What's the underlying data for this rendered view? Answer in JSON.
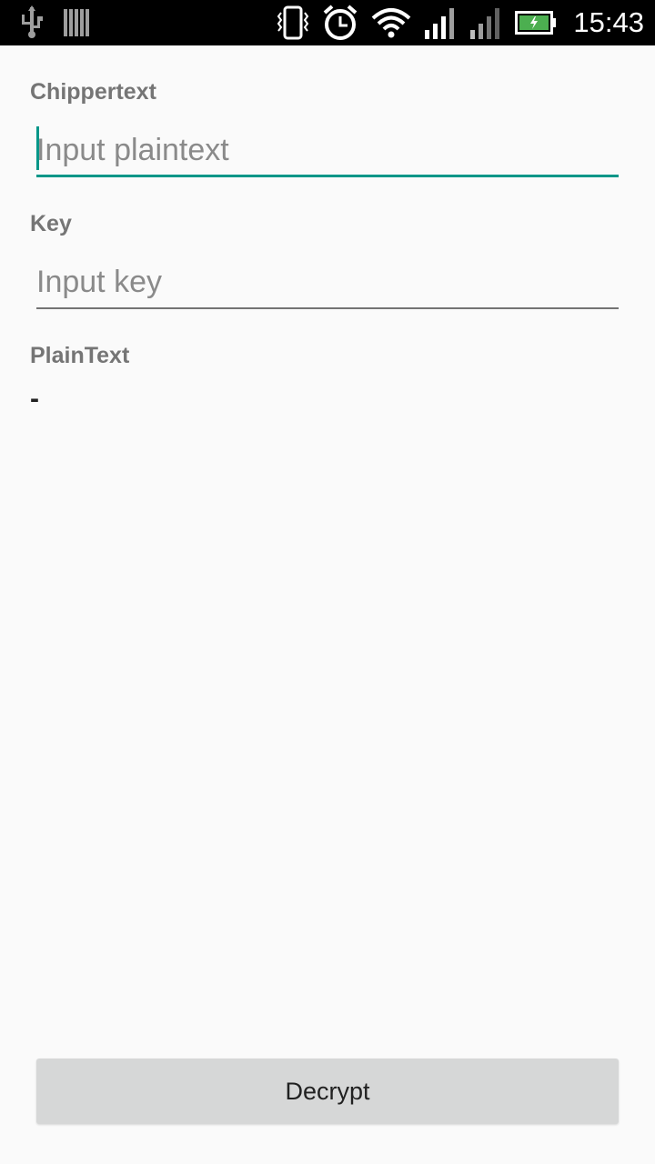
{
  "status_bar": {
    "time": "15:43",
    "icons": [
      "usb-icon",
      "storage-icon",
      "vibrate-icon",
      "alarm-icon",
      "wifi-icon",
      "signal-icon",
      "signal-secondary-icon",
      "battery-charging-icon"
    ],
    "battery_color": "#4caf50"
  },
  "form": {
    "ciphertext_label": "Chippertext",
    "ciphertext_placeholder": "Input plaintext",
    "ciphertext_value": "",
    "key_label": "Key",
    "key_placeholder": "Input key",
    "key_value": "",
    "plaintext_label": "PlainText",
    "plaintext_value": "-"
  },
  "actions": {
    "decrypt_label": "Decrypt"
  },
  "colors": {
    "accent": "#009688",
    "background": "#fafafa",
    "button": "#d6d7d7"
  }
}
